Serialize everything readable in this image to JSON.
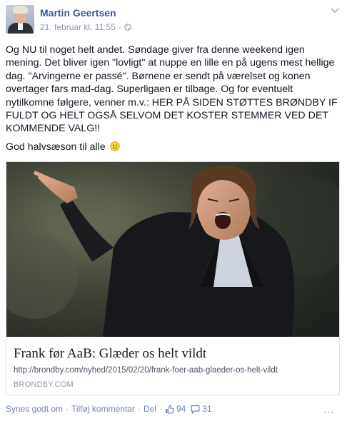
{
  "post": {
    "author": "Martin Geertsen",
    "date": "21. februar kl. 11:55",
    "paragraphs": [
      "Og NU til noget helt andet. Søndage giver fra denne weekend igen mening. Det bliver igen \"lovligt\" at nuppe en lille en på ugens mest hellige dag. \"Arvingerne er passé\". Børnene er sendt på værelset og konen overtager fars mad-dag. Superligaen er tilbage. Og for eventuelt nytilkomne følgere, venner m.v.: HER PÅ SIDEN STØTTES BRØNDBY IF FULDT OG HELT OGSÅ SELVOM DET KOSTER STEMMER VED DET KOMMENDE VALG!!",
      "God halvsæson til alle"
    ],
    "link": {
      "title": "Frank før AaB: Glæder os helt vildt",
      "url": "http://brondby.com/nyhed/2015/02/20/frank-foer-aab-glaeder-os-helt-vildt",
      "domain": "BRONDBY.COM"
    },
    "actions": {
      "like": "Synes godt om",
      "comment": "Tilføj kommentar",
      "share": "Del",
      "like_count": "94",
      "comment_count": "31",
      "more": "..."
    },
    "separator": "·"
  },
  "colors": {
    "link_blue": "#3b5998",
    "action_blue": "#6d84b4",
    "meta_gray": "#9197a3"
  },
  "icons": [
    "globe-icon",
    "chevron-down-icon",
    "smiley-icon",
    "thumbs-up-icon",
    "comment-icon",
    "more-icon"
  ]
}
